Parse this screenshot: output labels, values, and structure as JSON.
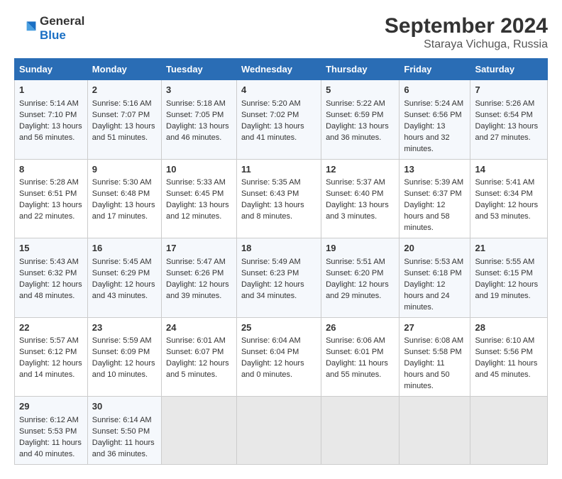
{
  "header": {
    "logo_line1": "General",
    "logo_line2": "Blue",
    "title": "September 2024",
    "subtitle": "Staraya Vichuga, Russia"
  },
  "weekdays": [
    "Sunday",
    "Monday",
    "Tuesday",
    "Wednesday",
    "Thursday",
    "Friday",
    "Saturday"
  ],
  "weeks": [
    [
      {
        "day": "1",
        "sunrise": "5:14 AM",
        "sunset": "7:10 PM",
        "daylight": "13 hours and 56 minutes."
      },
      {
        "day": "2",
        "sunrise": "5:16 AM",
        "sunset": "7:07 PM",
        "daylight": "13 hours and 51 minutes."
      },
      {
        "day": "3",
        "sunrise": "5:18 AM",
        "sunset": "7:05 PM",
        "daylight": "13 hours and 46 minutes."
      },
      {
        "day": "4",
        "sunrise": "5:20 AM",
        "sunset": "7:02 PM",
        "daylight": "13 hours and 41 minutes."
      },
      {
        "day": "5",
        "sunrise": "5:22 AM",
        "sunset": "6:59 PM",
        "daylight": "13 hours and 36 minutes."
      },
      {
        "day": "6",
        "sunrise": "5:24 AM",
        "sunset": "6:56 PM",
        "daylight": "13 hours and 32 minutes."
      },
      {
        "day": "7",
        "sunrise": "5:26 AM",
        "sunset": "6:54 PM",
        "daylight": "13 hours and 27 minutes."
      }
    ],
    [
      {
        "day": "8",
        "sunrise": "5:28 AM",
        "sunset": "6:51 PM",
        "daylight": "13 hours and 22 minutes."
      },
      {
        "day": "9",
        "sunrise": "5:30 AM",
        "sunset": "6:48 PM",
        "daylight": "13 hours and 17 minutes."
      },
      {
        "day": "10",
        "sunrise": "5:33 AM",
        "sunset": "6:45 PM",
        "daylight": "13 hours and 12 minutes."
      },
      {
        "day": "11",
        "sunrise": "5:35 AM",
        "sunset": "6:43 PM",
        "daylight": "13 hours and 8 minutes."
      },
      {
        "day": "12",
        "sunrise": "5:37 AM",
        "sunset": "6:40 PM",
        "daylight": "13 hours and 3 minutes."
      },
      {
        "day": "13",
        "sunrise": "5:39 AM",
        "sunset": "6:37 PM",
        "daylight": "12 hours and 58 minutes."
      },
      {
        "day": "14",
        "sunrise": "5:41 AM",
        "sunset": "6:34 PM",
        "daylight": "12 hours and 53 minutes."
      }
    ],
    [
      {
        "day": "15",
        "sunrise": "5:43 AM",
        "sunset": "6:32 PM",
        "daylight": "12 hours and 48 minutes."
      },
      {
        "day": "16",
        "sunrise": "5:45 AM",
        "sunset": "6:29 PM",
        "daylight": "12 hours and 43 minutes."
      },
      {
        "day": "17",
        "sunrise": "5:47 AM",
        "sunset": "6:26 PM",
        "daylight": "12 hours and 39 minutes."
      },
      {
        "day": "18",
        "sunrise": "5:49 AM",
        "sunset": "6:23 PM",
        "daylight": "12 hours and 34 minutes."
      },
      {
        "day": "19",
        "sunrise": "5:51 AM",
        "sunset": "6:20 PM",
        "daylight": "12 hours and 29 minutes."
      },
      {
        "day": "20",
        "sunrise": "5:53 AM",
        "sunset": "6:18 PM",
        "daylight": "12 hours and 24 minutes."
      },
      {
        "day": "21",
        "sunrise": "5:55 AM",
        "sunset": "6:15 PM",
        "daylight": "12 hours and 19 minutes."
      }
    ],
    [
      {
        "day": "22",
        "sunrise": "5:57 AM",
        "sunset": "6:12 PM",
        "daylight": "12 hours and 14 minutes."
      },
      {
        "day": "23",
        "sunrise": "5:59 AM",
        "sunset": "6:09 PM",
        "daylight": "12 hours and 10 minutes."
      },
      {
        "day": "24",
        "sunrise": "6:01 AM",
        "sunset": "6:07 PM",
        "daylight": "12 hours and 5 minutes."
      },
      {
        "day": "25",
        "sunrise": "6:04 AM",
        "sunset": "6:04 PM",
        "daylight": "12 hours and 0 minutes."
      },
      {
        "day": "26",
        "sunrise": "6:06 AM",
        "sunset": "6:01 PM",
        "daylight": "11 hours and 55 minutes."
      },
      {
        "day": "27",
        "sunrise": "6:08 AM",
        "sunset": "5:58 PM",
        "daylight": "11 hours and 50 minutes."
      },
      {
        "day": "28",
        "sunrise": "6:10 AM",
        "sunset": "5:56 PM",
        "daylight": "11 hours and 45 minutes."
      }
    ],
    [
      {
        "day": "29",
        "sunrise": "6:12 AM",
        "sunset": "5:53 PM",
        "daylight": "11 hours and 40 minutes."
      },
      {
        "day": "30",
        "sunrise": "6:14 AM",
        "sunset": "5:50 PM",
        "daylight": "11 hours and 36 minutes."
      },
      null,
      null,
      null,
      null,
      null
    ]
  ]
}
